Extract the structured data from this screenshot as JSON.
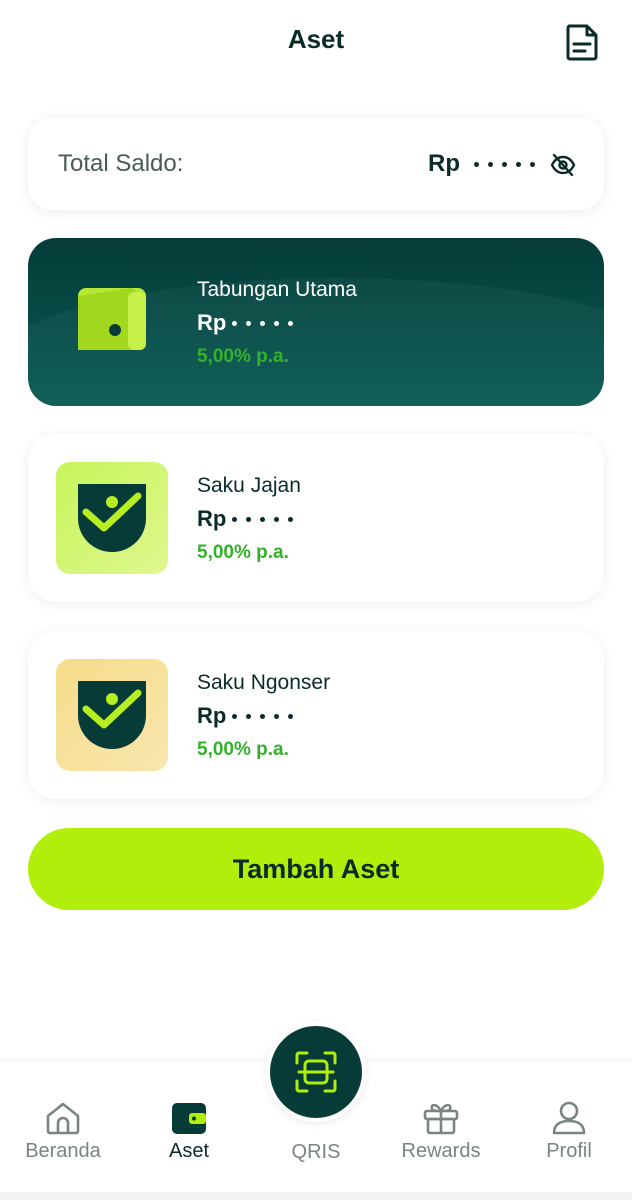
{
  "header": {
    "title": "Aset",
    "document_icon": "document-icon"
  },
  "saldo": {
    "label": "Total Saldo:",
    "currency": "Rp",
    "masked_dots": 5,
    "visibility_icon": "eye-off-icon"
  },
  "assets": [
    {
      "name": "Tabungan Utama",
      "currency": "Rp",
      "rate": "5,00% p.a.",
      "icon": "wallet-icon",
      "style": "dark"
    },
    {
      "name": "Saku Jajan",
      "currency": "Rp",
      "rate": "5,00% p.a.",
      "icon": "pocket-check-icon",
      "style": "green"
    },
    {
      "name": "Saku Ngonser",
      "currency": "Rp",
      "rate": "5,00% p.a.",
      "icon": "pocket-check-icon",
      "style": "yellow"
    }
  ],
  "actions": {
    "add_asset_label": "Tambah Aset"
  },
  "nav": {
    "items": [
      {
        "label": "Beranda",
        "icon": "home-icon"
      },
      {
        "label": "Aset",
        "icon": "wallet-icon",
        "active": true
      },
      {
        "label": "QRIS",
        "icon": "qr-scan-icon"
      },
      {
        "label": "Rewards",
        "icon": "gift-icon"
      },
      {
        "label": "Profil",
        "icon": "user-icon"
      }
    ]
  },
  "colors": {
    "primary_dark": "#053c39",
    "accent_lime": "#b1ee0c",
    "rate_green": "#34b12b"
  }
}
